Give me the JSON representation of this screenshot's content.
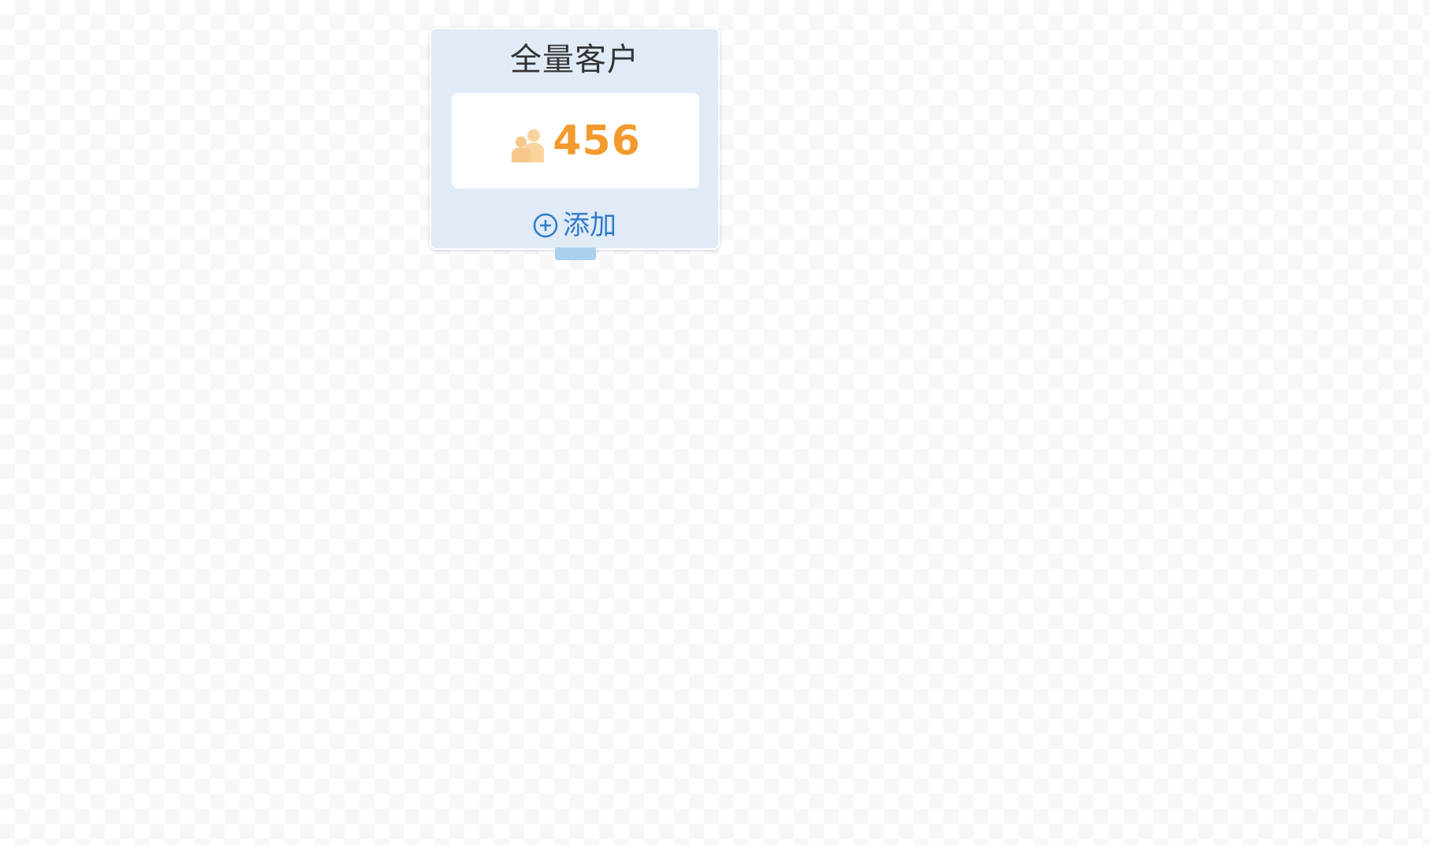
{
  "node": {
    "title": "全量客户",
    "count": "456",
    "add_label": "添加"
  },
  "icons": {
    "people": "people-icon",
    "add": "plus-circle-icon"
  },
  "colors": {
    "card_background": "#e0ebf7",
    "count_color": "#f29a2e",
    "people_icon_color": "#f8d39c",
    "link_color": "#2e7bc9",
    "connector_color": "#a9d0ee"
  }
}
